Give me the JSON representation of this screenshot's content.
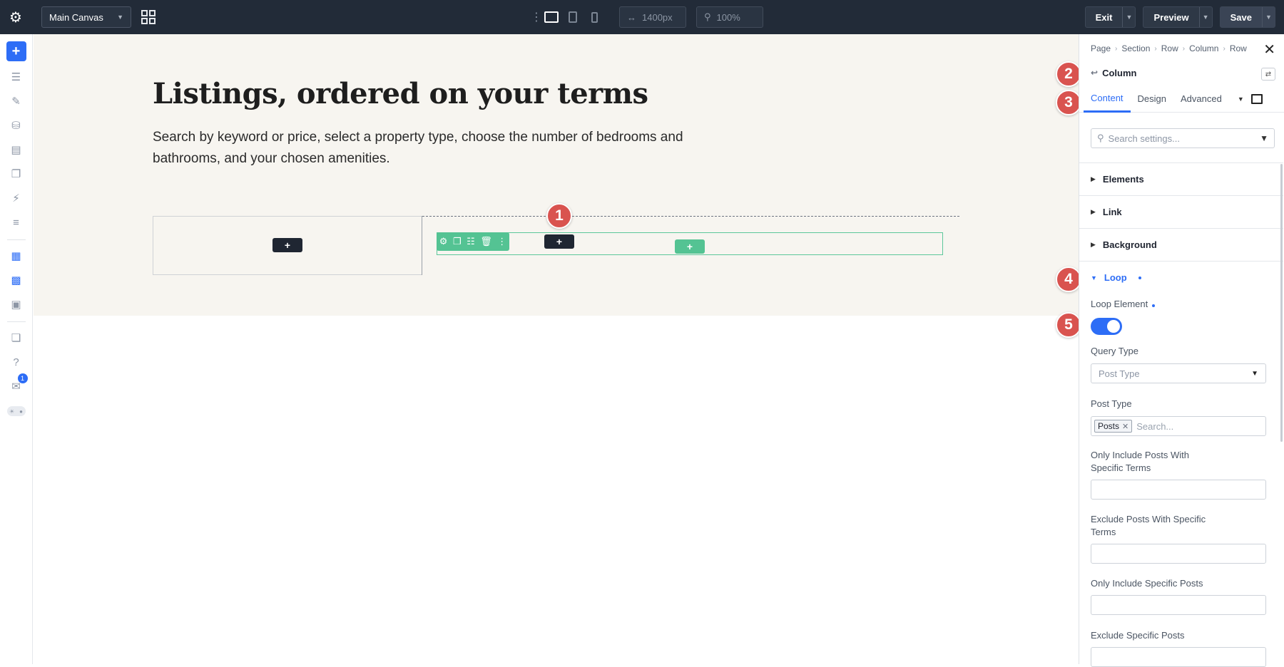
{
  "topbar": {
    "canvas_name": "Main Canvas",
    "width_value": "1400px",
    "zoom_value": "100%",
    "exit_label": "Exit",
    "preview_label": "Preview",
    "save_label": "Save"
  },
  "rail": {
    "notification_count": "1"
  },
  "canvas": {
    "hero_title": "Listings, ordered on your terms",
    "hero_text": "Search by keyword or price, select a property type, choose the number of bedrooms and bathrooms, and your chosen amenities.",
    "add_symbol": "+"
  },
  "markers": [
    "1",
    "2",
    "3",
    "4",
    "5"
  ],
  "panel": {
    "breadcrumbs": [
      "Page",
      "Section",
      "Row",
      "Column",
      "Row"
    ],
    "context_title": "Column",
    "tabs": [
      "Content",
      "Design",
      "Advanced"
    ],
    "search_placeholder": "Search settings...",
    "groups": {
      "elements": "Elements",
      "link": "Link",
      "background": "Background",
      "loop": "Loop"
    },
    "fields": {
      "loop_element": "Loop Element",
      "query_type": "Query Type",
      "query_type_value": "Post Type",
      "post_type": "Post Type",
      "post_type_tag": "Posts",
      "post_type_search": "Search...",
      "only_include_terms_1": "Only Include Posts With",
      "only_include_terms_2": "Specific Terms",
      "exclude_terms_1": "Exclude Posts With Specific",
      "exclude_terms_2": "Terms",
      "only_include_posts": "Only Include Specific Posts",
      "exclude_posts": "Exclude Specific Posts"
    }
  },
  "colors": {
    "accent": "#2d6df6",
    "topbar": "#222b38",
    "row_green": "#54c393",
    "marker_red": "#d9534f"
  }
}
